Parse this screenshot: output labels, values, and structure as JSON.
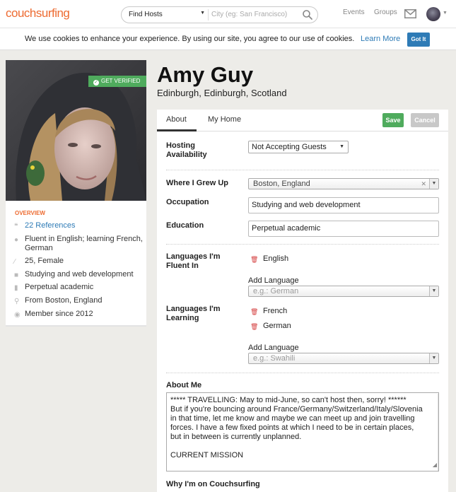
{
  "header": {
    "logo": "couchsurfing",
    "search_mode": "Find Hosts",
    "city_placeholder": "City (eg: San Francisco)",
    "nav_events": "Events",
    "nav_groups": "Groups"
  },
  "cookie": {
    "text": "We use cookies to enhance your experience. By using our site, you agree to our use of cookies.",
    "learn_more": "Learn More",
    "got_it": "Got It"
  },
  "profile": {
    "verified_badge": "GET VERIFIED",
    "name": "Amy Guy",
    "location": "Edinburgh, Edinburgh, Scotland"
  },
  "overview": {
    "title": "OVERVIEW",
    "references": "22 References",
    "languages": "Fluent in English; learning French, German",
    "age_gender": "25, Female",
    "occupation": "Studying and web development",
    "education": "Perpetual academic",
    "from": "From Boston, England",
    "member_since": "Member since 2012"
  },
  "tabs": {
    "about": "About",
    "my_home": "My Home",
    "save": "Save",
    "cancel": "Cancel"
  },
  "form": {
    "hosting_label": "Hosting Availability",
    "hosting_value": "Not Accepting Guests",
    "grew_up_label": "Where I Grew Up",
    "grew_up_value": "Boston, England",
    "occupation_label": "Occupation",
    "occupation_value": "Studying and web development",
    "education_label": "Education",
    "education_value": "Perpetual academic",
    "fluent_label": "Languages I'm Fluent In",
    "fluent": [
      "English"
    ],
    "add_language_label": "Add Language",
    "fluent_placeholder": "e.g.: German",
    "learning_label": "Languages I'm Learning",
    "learning": [
      "French",
      "German"
    ],
    "add_language_label_2": "Add Language",
    "learning_placeholder": "e.g.: Swahili",
    "about_me_label": "About Me",
    "about_me_lines": [
      "***** TRAVELLING: May to mid-June, so can't host then, sorry! ******",
      "But if you're bouncing around France/Germany/Switzerland/Italy/Slovenia",
      "in that time, let me know and maybe we can meet up and join travelling",
      "forces. I have a few fixed points at which I need to be in certain places,",
      "but in between is currently unplanned.",
      "",
      "CURRENT MISSION"
    ],
    "why_label": "Why I'm on Couchsurfing"
  },
  "colors": {
    "brand_orange": "#ed6b31",
    "link_blue": "#2e7bb6",
    "save_green": "#4fab5d",
    "delete_red": "#d43d3d"
  }
}
